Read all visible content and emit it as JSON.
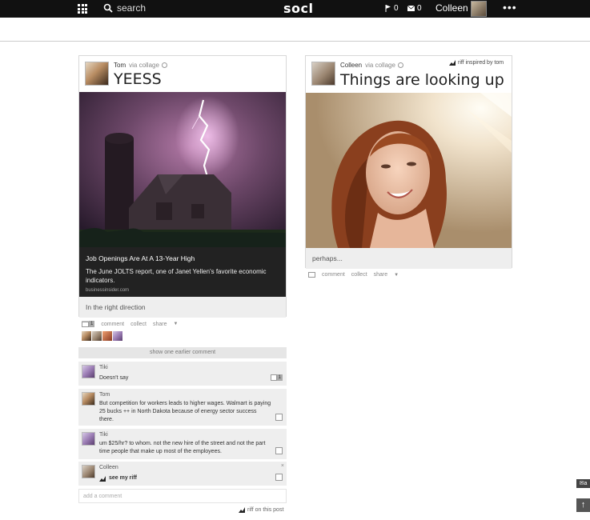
{
  "topbar": {
    "search_label": "search",
    "logo": "socl",
    "flag_count": "0",
    "mail_count": "0",
    "user_name": "Colleen",
    "more_label": "•••"
  },
  "post1": {
    "author": "Tom",
    "via": "via collage",
    "title": "YEESS",
    "article_headline": "Job Openings Are At A 13-Year High",
    "article_desc": "The June JOLTS report, one of Janet Yellen's favorite economic indicators.",
    "article_source": "businessinsider.com",
    "caption": "In the right direction",
    "comment_count": "1",
    "comment_label": "comment",
    "collect_label": "collect",
    "share_label": "share",
    "show_earlier": "show one earlier comment"
  },
  "comments": [
    {
      "author": "Tiki",
      "text": "Doesn't say",
      "count": "1"
    },
    {
      "author": "Tom",
      "text": "But competition for workers leads to higher wages. Walmart is paying 25 bucks ++ in North Dakota because of energy sector success there."
    },
    {
      "author": "Tiki",
      "text": "um $25/hr? to whom. not the new hire of the street and not the part time people that make up most of the employees."
    },
    {
      "author": "Colleen",
      "text": "see my riff",
      "close": "×"
    }
  ],
  "add_comment_placeholder": "add a comment",
  "riff_on_post": "riff on this post",
  "post2": {
    "author": "Colleen",
    "via": "via collage",
    "riff_note": "riff inspired by tom",
    "title": "Things are looking up",
    "caption": "perhaps...",
    "comment_label": "comment",
    "collect_label": "collect",
    "share_label": "share"
  },
  "side": {
    "feedback_label": "✉a",
    "top_label": "↑"
  }
}
